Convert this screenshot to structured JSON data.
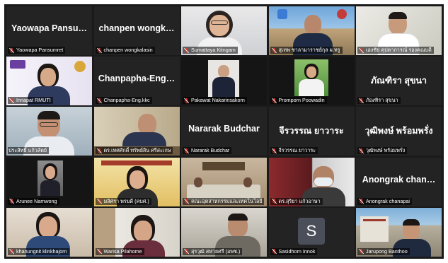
{
  "colors": {
    "active_border": "#c8e83a",
    "muted_icon": "#e0352b"
  },
  "icons": {
    "muted": "mic-muted-icon"
  },
  "participants": [
    {
      "id": "yaowapa",
      "label": "Yaowapa Pansumret",
      "display_name": "Yaowapa Pansu…",
      "video": false,
      "muted": true
    },
    {
      "id": "chanpen",
      "label": "chanpen wongkalasin",
      "display_name": "chanpen wongk…",
      "video": false,
      "muted": true
    },
    {
      "id": "sumattaya",
      "label": "Sumattaya Kitngam",
      "video": true,
      "muted": true
    },
    {
      "id": "suthep",
      "label": "สุเทพ ชาลามาราชย์กุล ผ.ทรู",
      "video": true,
      "muted": true
    },
    {
      "id": "songkiat",
      "label": "เองชัย คุปตาการณ์ รองคณบดี",
      "video": true,
      "muted": true
    },
    {
      "id": "innapat",
      "label": "Innapat RMUTI",
      "video": true,
      "muted": true
    },
    {
      "id": "champapha",
      "label": "Chanpapha-Eng.kkc",
      "display_name": "Chanpapha-Eng…",
      "video": false,
      "muted": true
    },
    {
      "id": "pakawat",
      "label": "Pakawat Nakarinsakorn",
      "video": true,
      "muted": true
    },
    {
      "id": "promporn",
      "label": "Promporn Poowadin",
      "video": true,
      "muted": true
    },
    {
      "id": "pansira",
      "label": "ภัณฑิรา สุขนา",
      "display_name": "ภัณฑิรา สุขนา",
      "video": false,
      "muted": true
    },
    {
      "id": "prasit",
      "label": "ประสิทธิ์ แก้วสัตย์",
      "video": true,
      "muted": false,
      "active": true
    },
    {
      "id": "tessasak",
      "label": "ดร.เทศศักดิ์ ทรัพย์สิน ศรีสะเกษ",
      "video": true,
      "muted": true
    },
    {
      "id": "nararak",
      "label": "Nararak Budchar",
      "display_name": "Nararak Budchar",
      "video": false,
      "muted": true
    },
    {
      "id": "jiraporn",
      "label": "จีรวรรณ ยาวาระ",
      "display_name": "จีรวรรณ ยาวาระ",
      "video": false,
      "muted": true
    },
    {
      "id": "wutthipong",
      "label": "วุฒิพงษ์ พร้อมพรั่ง",
      "display_name": "วุฒิพงษ์ พร้อมพรั่ง",
      "video": false,
      "muted": true
    },
    {
      "id": "arunee",
      "label": "Arunee Namwong",
      "video": true,
      "muted": true
    },
    {
      "id": "malisa",
      "label": "มลิศรา พรมดี (คบศ.)",
      "video": true,
      "muted": true
    },
    {
      "id": "faculty",
      "label": "คณะอุตสาหกรรมและเทคโนโลยี",
      "video": true,
      "muted": true
    },
    {
      "id": "surachai",
      "label": "ดร.สุริยา แก้วอาษา",
      "video": true,
      "muted": true
    },
    {
      "id": "anongrak",
      "label": "Anongrak chanapai",
      "display_name": "Anongrak chan…",
      "video": false,
      "muted": true
    },
    {
      "id": "khanungnit",
      "label": "khanungnit klinkhajorn",
      "video": true,
      "muted": true
    },
    {
      "id": "warisa",
      "label": "Warisa Pilahome",
      "video": true,
      "muted": true
    },
    {
      "id": "sarawut",
      "label": "สุรวุฒิ สหายศรี (อพช.)",
      "video": true,
      "muted": true
    },
    {
      "id": "sasidhorn",
      "label": "Sasidhorn Innok",
      "avatar_letter": "S",
      "video": false,
      "muted": true
    },
    {
      "id": "jarupong",
      "label": "Jarupong Banthoo",
      "video": true,
      "muted": true
    }
  ]
}
